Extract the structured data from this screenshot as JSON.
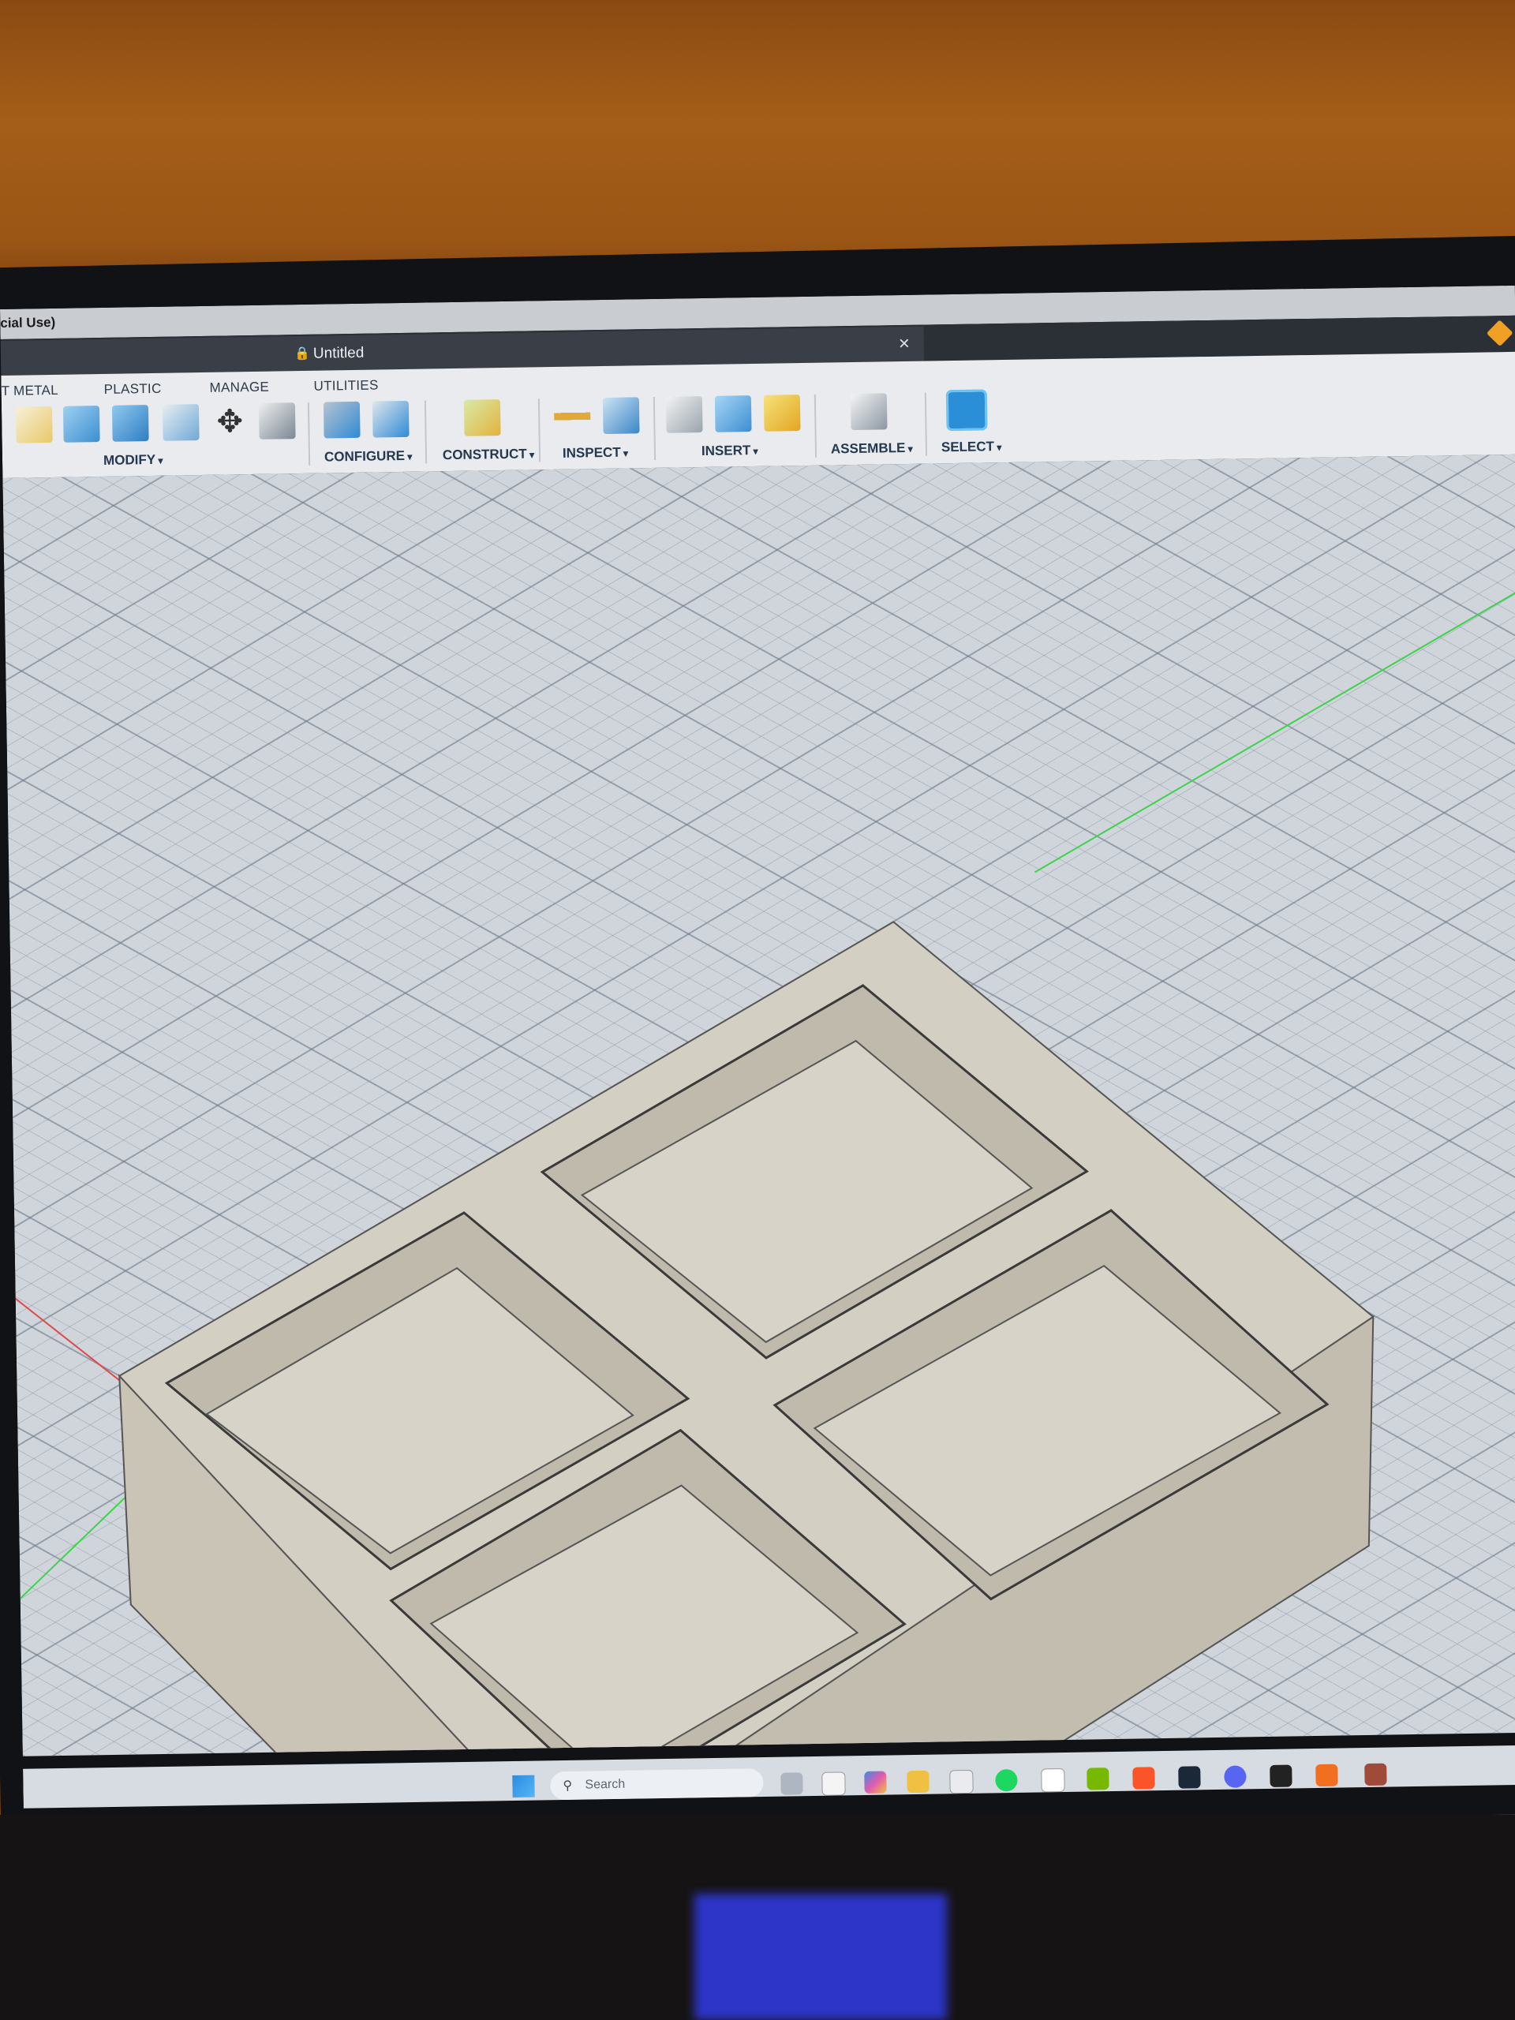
{
  "window": {
    "title_fragment": "cial Use)"
  },
  "document_tab": {
    "name": "Untitled",
    "close_glyph": "×"
  },
  "toolbar": {
    "tabs": [
      "T METAL",
      "PLASTIC",
      "MANAGE",
      "UTILITIES"
    ],
    "groups": [
      "MODIFY",
      "CONFIGURE",
      "CONSTRUCT",
      "INSPECT",
      "INSERT",
      "ASSEMBLE",
      "SELECT"
    ]
  },
  "taskbar": {
    "search_placeholder": "Search"
  },
  "icons": {
    "lock": "lock-icon",
    "close": "close-icon",
    "search": "search-icon",
    "start": "windows-start-icon"
  },
  "colors": {
    "accent": "#f0a022",
    "select_highlight": "#2a8fd6",
    "viewport": "#cfd5db",
    "model": "#cbc6b8"
  }
}
